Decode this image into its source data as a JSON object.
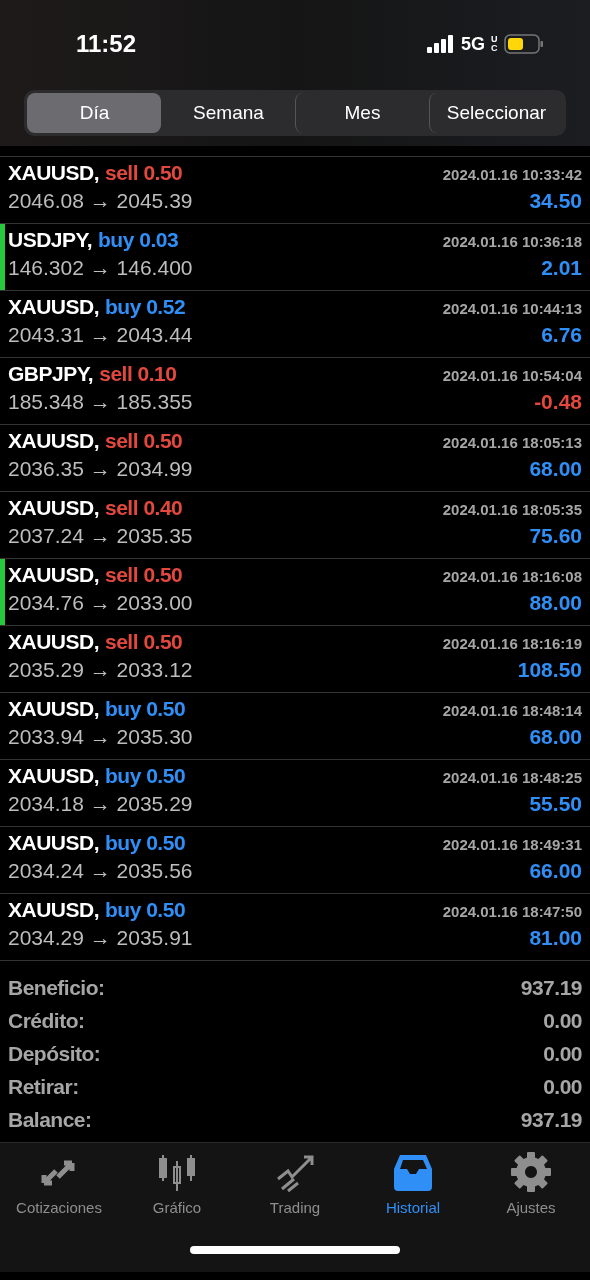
{
  "status_bar": {
    "time": "11:52",
    "network": "5G",
    "network_sub": "UC"
  },
  "period_tabs": [
    {
      "label": "Día",
      "selected": true
    },
    {
      "label": "Semana",
      "selected": false
    },
    {
      "label": "Mes",
      "selected": false
    },
    {
      "label": "Seleccionar",
      "selected": false
    }
  ],
  "deals": [
    {
      "symbol": "XAUUSD,",
      "kind": "sell",
      "order": "sell 0.50",
      "time": "2024.01.16 10:33:42",
      "prices": "2046.08 → 2045.39",
      "profit": "34.50",
      "loss": false,
      "marked": false
    },
    {
      "symbol": "USDJPY,",
      "kind": "buy",
      "order": "buy 0.03",
      "time": "2024.01.16 10:36:18",
      "prices": "146.302 → 146.400",
      "profit": "2.01",
      "loss": false,
      "marked": true
    },
    {
      "symbol": "XAUUSD,",
      "kind": "buy",
      "order": "buy 0.52",
      "time": "2024.01.16 10:44:13",
      "prices": "2043.31 → 2043.44",
      "profit": "6.76",
      "loss": false,
      "marked": false
    },
    {
      "symbol": "GBPJPY,",
      "kind": "sell",
      "order": "sell 0.10",
      "time": "2024.01.16 10:54:04",
      "prices": "185.348 → 185.355",
      "profit": "-0.48",
      "loss": true,
      "marked": false
    },
    {
      "symbol": "XAUUSD,",
      "kind": "sell",
      "order": "sell 0.50",
      "time": "2024.01.16 18:05:13",
      "prices": "2036.35 → 2034.99",
      "profit": "68.00",
      "loss": false,
      "marked": false
    },
    {
      "symbol": "XAUUSD,",
      "kind": "sell",
      "order": "sell 0.40",
      "time": "2024.01.16 18:05:35",
      "prices": "2037.24 → 2035.35",
      "profit": "75.60",
      "loss": false,
      "marked": false
    },
    {
      "symbol": "XAUUSD,",
      "kind": "sell",
      "order": "sell 0.50",
      "time": "2024.01.16 18:16:08",
      "prices": "2034.76 → 2033.00",
      "profit": "88.00",
      "loss": false,
      "marked": true
    },
    {
      "symbol": "XAUUSD,",
      "kind": "sell",
      "order": "sell 0.50",
      "time": "2024.01.16 18:16:19",
      "prices": "2035.29 → 2033.12",
      "profit": "108.50",
      "loss": false,
      "marked": false
    },
    {
      "symbol": "XAUUSD,",
      "kind": "buy",
      "order": "buy 0.50",
      "time": "2024.01.16 18:48:14",
      "prices": "2033.94 → 2035.30",
      "profit": "68.00",
      "loss": false,
      "marked": false
    },
    {
      "symbol": "XAUUSD,",
      "kind": "buy",
      "order": "buy 0.50",
      "time": "2024.01.16 18:48:25",
      "prices": "2034.18 → 2035.29",
      "profit": "55.50",
      "loss": false,
      "marked": false
    },
    {
      "symbol": "XAUUSD,",
      "kind": "buy",
      "order": "buy 0.50",
      "time": "2024.01.16 18:49:31",
      "prices": "2034.24 → 2035.56",
      "profit": "66.00",
      "loss": false,
      "marked": false
    },
    {
      "symbol": "XAUUSD,",
      "kind": "buy",
      "order": "buy 0.50",
      "time": "2024.01.16 18:47:50",
      "prices": "2034.29 → 2035.91",
      "profit": "81.00",
      "loss": false,
      "marked": false
    }
  ],
  "summary": [
    {
      "label": "Beneficio:",
      "value": "937.19"
    },
    {
      "label": "Crédito:",
      "value": "0.00"
    },
    {
      "label": "Depósito:",
      "value": "0.00"
    },
    {
      "label": "Retirar:",
      "value": "0.00"
    },
    {
      "label": "Balance:",
      "value": "937.19"
    }
  ],
  "tab_bar": [
    {
      "kind": "quotes",
      "label": "Cotizaciones",
      "selected": false
    },
    {
      "kind": "chart",
      "label": "Gráfico",
      "selected": false
    },
    {
      "kind": "trade",
      "label": "Trading",
      "selected": false
    },
    {
      "kind": "history",
      "label": "Historial",
      "selected": true
    },
    {
      "kind": "settings",
      "label": "Ajustes",
      "selected": false
    }
  ]
}
